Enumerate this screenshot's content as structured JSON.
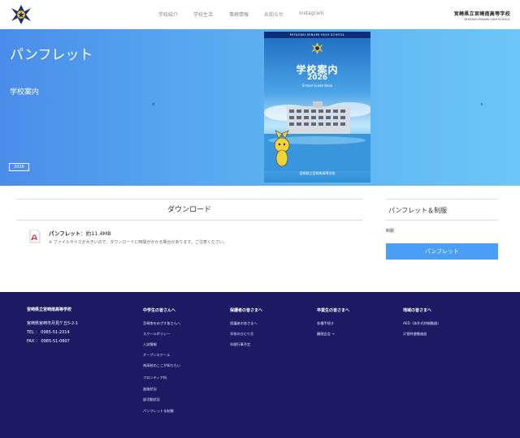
{
  "header": {
    "nav": [
      "学校紹介",
      "学校生活",
      "事務情報",
      "お知らせ",
      "Instagram"
    ],
    "school_name_jp": "宮崎県立宮崎南高等学校",
    "school_name_en": "MIYAZAKI MINAMI HIGH SCHOOL"
  },
  "hero": {
    "title": "パンフレット",
    "subtitle": "学校案内",
    "year": "2026",
    "prev_arrow": "‹",
    "next_arrow": "›",
    "cover": {
      "top_text": "MIYAZAKI MINAMI HIGH SCHOOL",
      "title": "学校案内",
      "year": "2026",
      "guide": "School Guide Book",
      "foot": "宮崎県立宮崎南高等学校"
    }
  },
  "download": {
    "section_title": "ダウンロード",
    "file_label": "パンフレット",
    "file_size": "：約11.4MB",
    "note": "※ ファイルサイズが大きいので、ダウンロードに時間がかかる場合があります。ご注意ください。"
  },
  "sidebar": {
    "title": "パンフレット＆制服",
    "item": "制服",
    "button": "パンフレット"
  },
  "footer": {
    "school_name": "宮崎県立宮崎南高等学校",
    "address": "宮崎県宮崎市月見ケ丘5-2-1",
    "tel": "TEL ： 0985-51-2314",
    "fax": "FAX ： 0985-51-0607",
    "columns": [
      {
        "title": "中学生の皆さんへ",
        "links": [
          "宮崎南をめざす皆さんへ",
          "スクールポリシー",
          "入試情報",
          "オープンスクール",
          "南高校のここが知りたい",
          "フロンティア科",
          "進路状況",
          "部活動状況",
          "パンフレット＆制服"
        ]
      },
      {
        "title": "保護者の皆さまへ",
        "links": [
          "保護者の皆さまへ",
          "学校のひとり言",
          "年間行事予定"
        ]
      },
      {
        "title": "卒業生の皆さまへ",
        "links": [
          "各種手続き",
          "鵬翔会会 →"
        ]
      },
      {
        "title": "地域の皆さまへ",
        "links": [
          "AED（体外式除細動器）",
          "災害時避難施設"
        ]
      }
    ]
  },
  "colors": {
    "accent": "#4a9ef3",
    "footer_bg": "#1b1a62"
  }
}
